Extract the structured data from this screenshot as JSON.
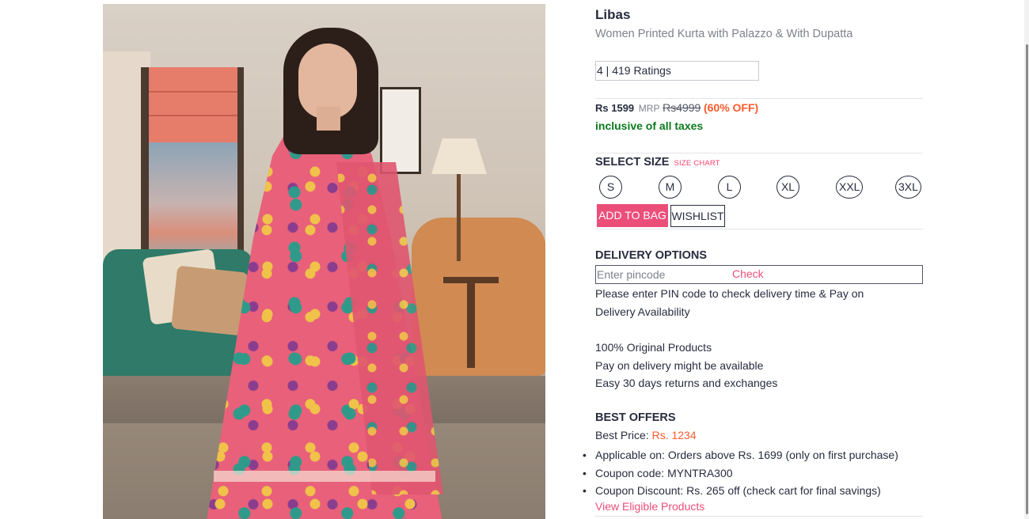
{
  "product": {
    "brand": "Libas",
    "name": "Women Printed Kurta with Palazzo & With Dupatta",
    "ratings": "4 | 419 Ratings",
    "price": "Rs 1599",
    "mrp_label": "MRP",
    "mrp": "Rs4999",
    "discount": "(60% OFF)",
    "tax_note": "inclusive of all taxes"
  },
  "size": {
    "heading": "SELECT SIZE",
    "chart_link": "SIZE CHART",
    "options": [
      "S",
      "M",
      "L",
      "XL",
      "XXL",
      "3XL"
    ]
  },
  "actions": {
    "add_to_bag": "ADD TO BAG",
    "wishlist": "WISHLIST"
  },
  "delivery": {
    "heading": "DELIVERY OPTIONS",
    "pincode_placeholder": "Enter pincode",
    "check_label": "Check",
    "info": "Please enter PIN code to check delivery time & Pay on Delivery Availability",
    "assurances": [
      "100% Original Products",
      "Pay on delivery might be available",
      "Easy 30 days returns and exchanges"
    ]
  },
  "offers": {
    "heading": "BEST OFFERS",
    "best_price_label": "Best Price:",
    "best_price_value": "Rs. 1234",
    "items": [
      "Applicable on: Orders above Rs. 1699 (only on first purchase)",
      "Coupon code: MYNTRA300",
      "Coupon Discount: Rs. 265 off (check cart for final savings)"
    ],
    "view_eligible": "View Eligible Products"
  },
  "colors": {
    "accent_pink": "#ec4e7a",
    "discount_orange": "#ff5a2c",
    "tax_green": "#0b7a1d",
    "text_dark": "#282c3f",
    "text_muted": "#7e818c"
  }
}
